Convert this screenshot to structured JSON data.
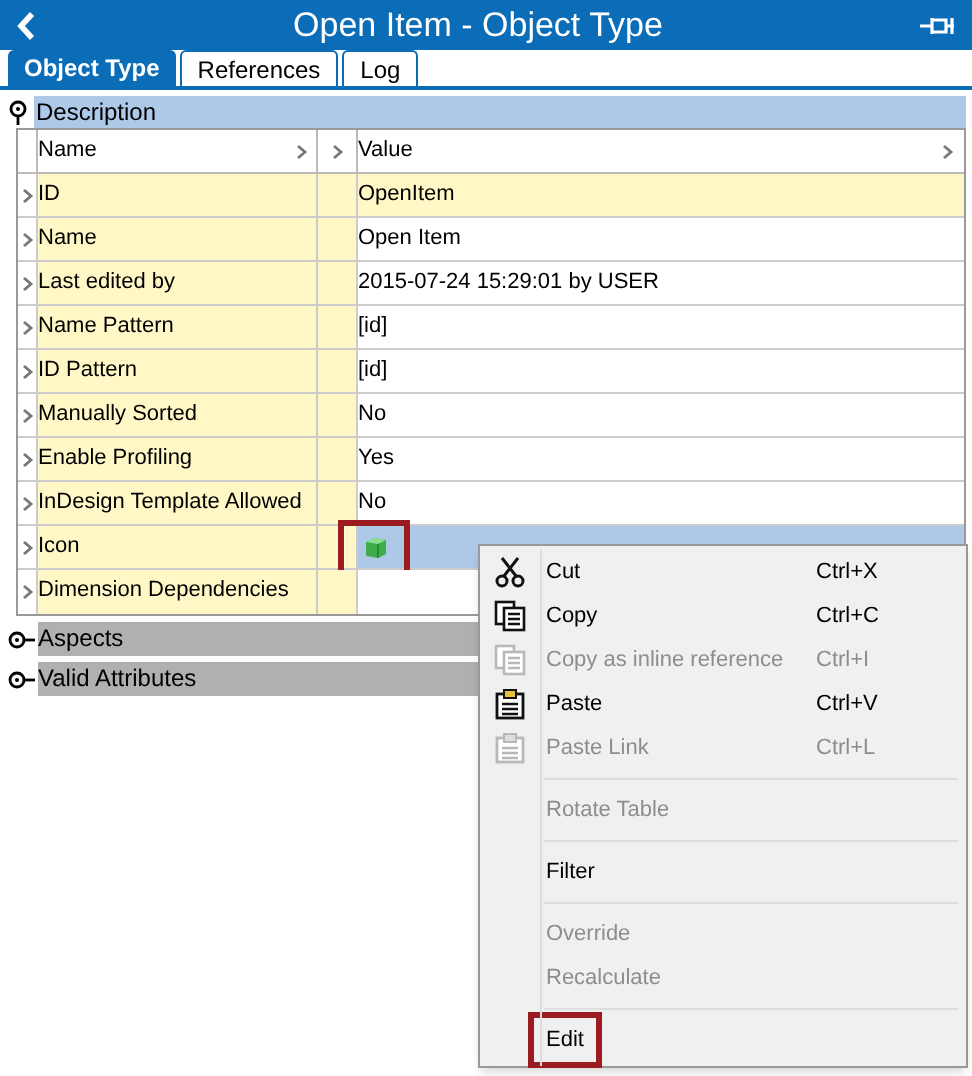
{
  "window": {
    "title": "Open Item - Object Type"
  },
  "tabs": [
    {
      "label": "Object Type",
      "selected": true
    },
    {
      "label": "References",
      "selected": false
    },
    {
      "label": "Log",
      "selected": false
    }
  ],
  "description": {
    "title": "Description",
    "expanded": true,
    "columns": [
      "Name",
      "Value"
    ],
    "rows": [
      {
        "name": "ID",
        "value": "OpenItem",
        "highlighted": true,
        "selected": false,
        "outlined": false,
        "kind": "text"
      },
      {
        "name": "Name",
        "value": "Open Item",
        "highlighted": false,
        "selected": false,
        "outlined": false,
        "kind": "text"
      },
      {
        "name": "Last edited by",
        "value": "2015-07-24 15:29:01 by USER",
        "highlighted": false,
        "selected": false,
        "outlined": false,
        "kind": "text"
      },
      {
        "name": "Name Pattern",
        "value": "[id]",
        "highlighted": false,
        "selected": false,
        "outlined": false,
        "kind": "text"
      },
      {
        "name": "ID Pattern",
        "value": "[id]",
        "highlighted": false,
        "selected": false,
        "outlined": false,
        "kind": "text"
      },
      {
        "name": "Manually Sorted",
        "value": "No",
        "highlighted": false,
        "selected": false,
        "outlined": false,
        "kind": "text"
      },
      {
        "name": "Enable Profiling",
        "value": "Yes",
        "highlighted": false,
        "selected": false,
        "outlined": false,
        "kind": "text"
      },
      {
        "name": "InDesign Template Allowed",
        "value": "No",
        "highlighted": false,
        "selected": false,
        "outlined": false,
        "kind": "text"
      },
      {
        "name": "Icon",
        "highlighted": false,
        "selected": true,
        "outlined": true,
        "kind": "icon"
      },
      {
        "name": "Dimension Dependencies",
        "highlighted": false,
        "selected": false,
        "outlined": false,
        "kind": "text"
      }
    ]
  },
  "sections": [
    {
      "title": "Aspects",
      "expanded": false
    },
    {
      "title": "Valid Attributes",
      "expanded": false
    }
  ],
  "context_menu": [
    {
      "kind": "cut",
      "label": "Cut",
      "shortcut": "Ctrl+X",
      "disabled": false,
      "outlined": false
    },
    {
      "kind": "copy",
      "label": "Copy",
      "shortcut": "Ctrl+C",
      "disabled": false,
      "outlined": false
    },
    {
      "kind": "copy",
      "label": "Copy as inline reference",
      "shortcut": "Ctrl+I",
      "disabled": true,
      "outlined": false
    },
    {
      "kind": "paste",
      "label": "Paste",
      "shortcut": "Ctrl+V",
      "disabled": false,
      "outlined": false
    },
    {
      "kind": "paste",
      "label": "Paste Link",
      "shortcut": "Ctrl+L",
      "disabled": true,
      "outlined": false
    },
    {
      "kind": "separator"
    },
    {
      "kind": "plain",
      "label": "Rotate Table",
      "disabled": true,
      "outlined": false
    },
    {
      "kind": "separator"
    },
    {
      "kind": "plain",
      "label": "Filter",
      "disabled": false,
      "outlined": false
    },
    {
      "kind": "separator"
    },
    {
      "kind": "plain",
      "label": "Override",
      "disabled": true,
      "outlined": false
    },
    {
      "kind": "plain",
      "label": "Recalculate",
      "disabled": true,
      "outlined": false
    },
    {
      "kind": "separator"
    },
    {
      "kind": "plain",
      "label": "Edit",
      "disabled": false,
      "outlined": true
    }
  ]
}
